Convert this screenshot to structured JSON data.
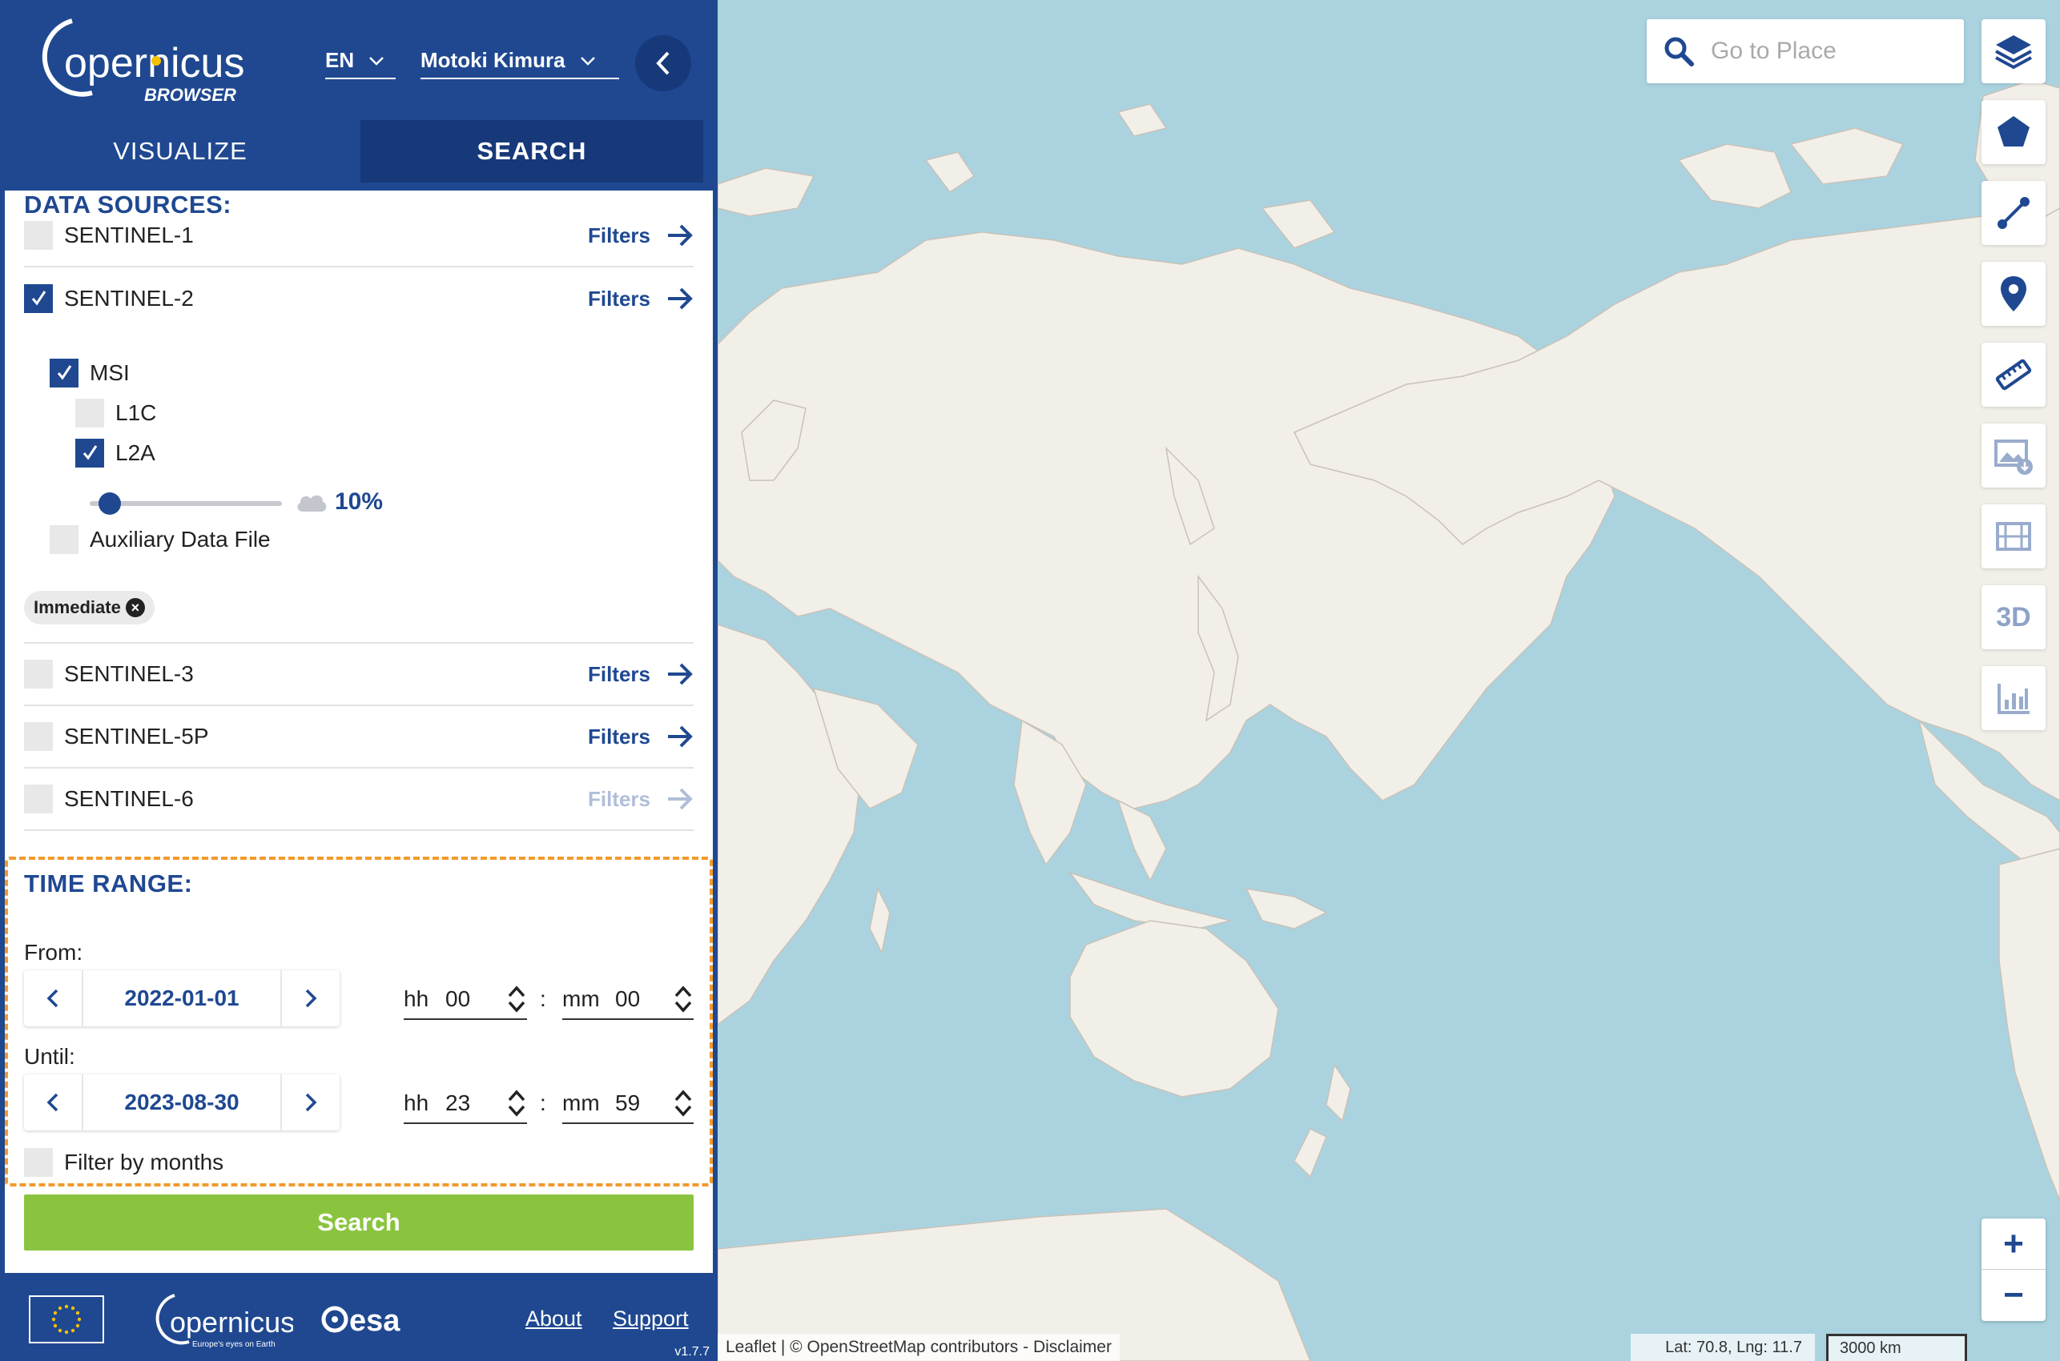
{
  "header": {
    "logo_main": "opernicus",
    "logo_sub": "BROWSER",
    "language": "EN",
    "user_name": "Motoki Kimura",
    "tabs": [
      {
        "label": "VISUALIZE"
      },
      {
        "label": "SEARCH"
      }
    ]
  },
  "data_sources": {
    "title": "DATA SOURCES:",
    "filters_label": "Filters",
    "sentinel1": "SENTINEL-1",
    "sentinel2": "SENTINEL-2",
    "msi": "MSI",
    "l1c": "L1C",
    "l2a": "L2A",
    "cloud_coverage": "10%",
    "cloud_fraction": 0.1,
    "aux_file": "Auxiliary Data File",
    "tag": "Immediate",
    "sentinel3": "SENTINEL-3",
    "sentinel5p": "SENTINEL-5P",
    "sentinel6": "SENTINEL-6"
  },
  "time_range": {
    "title": "TIME RANGE:",
    "from_label": "From:",
    "from_date": "2022-01-01",
    "from_hh": "00",
    "from_mm": "00",
    "until_label": "Until:",
    "until_date": "2023-08-30",
    "until_hh": "23",
    "until_mm": "59",
    "hh_label": "hh",
    "mm_label": "mm",
    "colon": ":",
    "filter_months": "Filter by months"
  },
  "search_button": "Search",
  "footer": {
    "copernicus_logo": "opernicus",
    "copernicus_tagline": "Europe's eyes on Earth",
    "esa_logo": "esa",
    "about": "About",
    "support": "Support",
    "version": "v1.7.7"
  },
  "map": {
    "search_placeholder": "Go to Place",
    "attribution": "Leaflet | © OpenStreetMap contributors - Disclaimer",
    "coords": "Lat: 70.8, Lng: 11.7",
    "scale": "3000 km",
    "tool_3d": "3D",
    "zoom_in": "+",
    "zoom_out": "−",
    "colors": {
      "water": "#aad3df",
      "land": "#f2efe9",
      "brand": "#1f4891",
      "accent": "#f39a2c",
      "search": "#8ac43f"
    }
  },
  "icons": {
    "toolbar": [
      "layers-icon",
      "polygon-icon",
      "line-icon",
      "pin-icon",
      "ruler-icon",
      "image-download-icon",
      "film-icon",
      "3d-icon",
      "chart-icon"
    ]
  }
}
